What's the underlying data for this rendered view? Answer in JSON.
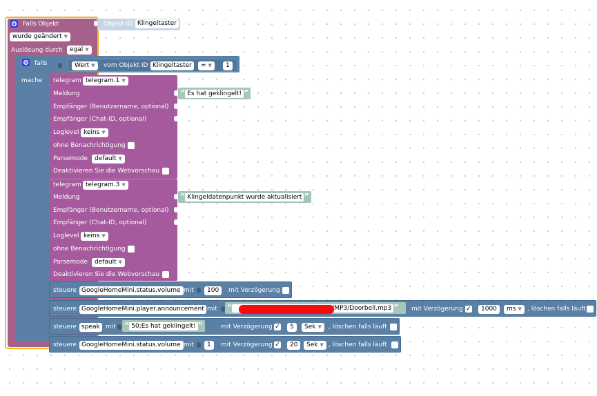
{
  "trigger": {
    "title": "Falls Objekt",
    "objekt_id_label": "Objekt ID",
    "objekt_id_value": "Klingeltaster",
    "wurde": "wurde geändert",
    "ausloesung_label": "Auslösung durch",
    "ausloesung_value": "egal"
  },
  "if_block": {
    "falls": "falls",
    "mache": "mache",
    "wert": "Wert",
    "vom_objekt": "vom Objekt ID",
    "objekt_value": "Klingeltaster",
    "operator": "=",
    "compare_value": "1"
  },
  "telegram_blocks": [
    {
      "telegram_label": "telegram",
      "instance": "telegram.1",
      "meldung_label": "Meldung",
      "meldung_text": "Es hat geklingelt!",
      "empfaenger_user": "Empfänger (Benutzername, optional)",
      "empfaenger_chat": "Empfänger (Chat-ID, optional)",
      "loglevel_label": "Loglevel",
      "loglevel_value": "keins",
      "ohne_label": "ohne Benachrichtigung",
      "parsemode_label": "Parsemode",
      "parsemode_value": "default",
      "deaktivieren_label": "Deaktivieren Sie die Webvorschau"
    },
    {
      "telegram_label": "telegram",
      "instance": "telegram.3",
      "meldung_label": "Meldung",
      "meldung_text": "Klingeldatenpunkt wurde aktualisiert",
      "empfaenger_user": "Empfänger (Benutzername, optional)",
      "empfaenger_chat": "Empfänger (Chat-ID, optional)",
      "loglevel_label": "Loglevel",
      "loglevel_value": "keins",
      "ohne_label": "ohne Benachrichtigung",
      "parsemode_label": "Parsemode",
      "parsemode_value": "default",
      "deaktivieren_label": "Deaktivieren Sie die Webvorschau"
    }
  ],
  "control_blocks": [
    {
      "steuere": "steuere",
      "target": "GoogleHomeMini.status.volume",
      "mit": "mit",
      "value": "100",
      "verzoegerung": "mit Verzögerung"
    },
    {
      "steuere": "steuere",
      "target": "GoogleHomeMini.player.announcement",
      "mit": "mit",
      "string_value": "0/MP3/Doorbell.mp3",
      "verzoegerung": "mit Verzögerung",
      "delay_value": "1000",
      "unit": "ms",
      "loeschen": ", löschen falls läuft"
    },
    {
      "steuere": "steuere",
      "target": "speak",
      "mit": "mit",
      "string_value": "50;Es hat geklingelt!",
      "verzoegerung": "mit Verzögerung",
      "delay_value": "5",
      "unit": "Sek",
      "loeschen": ", löschen falls läuft"
    },
    {
      "steuere": "steuere",
      "target": "GoogleHomeMini.status.volume",
      "mit": "mit",
      "value": "1",
      "verzoegerung": "mit Verzögerung",
      "delay_value": "20",
      "unit": "Sek",
      "loeschen": ", löschen falls läuft"
    }
  ],
  "colors": {
    "trigger": "#a5618a",
    "logic": "#5b80a5",
    "telegram": "#a55a9d",
    "string": "#a5c6b8",
    "highlight": "#f2b81e"
  }
}
